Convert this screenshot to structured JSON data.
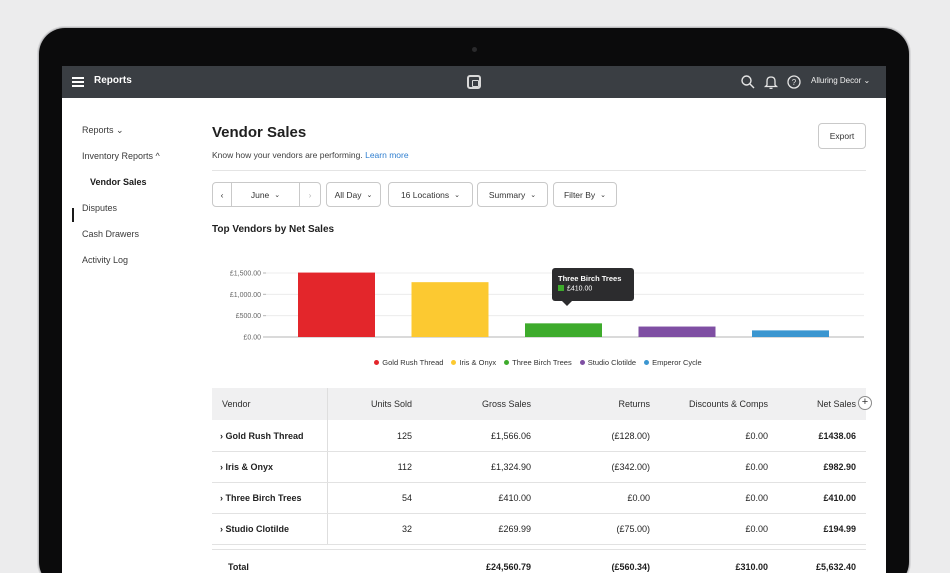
{
  "topbar": {
    "title": "Reports",
    "account": "Alluring Decor ⌄"
  },
  "sidebar": {
    "items": [
      {
        "label": "Reports ⌄"
      },
      {
        "label": "Inventory Reports  ^"
      },
      {
        "label": "Vendor Sales"
      },
      {
        "label": "Disputes"
      },
      {
        "label": "Cash Drawers"
      },
      {
        "label": "Activity Log"
      }
    ]
  },
  "page": {
    "title": "Vendor Sales",
    "subtitle": "Know how your vendors are performing.",
    "learn_more": "Learn more",
    "export": "Export"
  },
  "filters": {
    "prev": "‹",
    "month": "June",
    "next": "›",
    "allday": "All Day",
    "locations": "16 Locations",
    "summary": "Summary",
    "filterby": "Filter By",
    "chevron": "⌄"
  },
  "chart_title": "Top Vendors by Net Sales",
  "chart_data": {
    "type": "bar",
    "categories": [
      "Gold Rush Thread",
      "Iris & Onyx",
      "Three Birch Trees",
      "Studio Clotilde",
      "Emperor Cycle"
    ],
    "values": [
      1510,
      1285,
      320,
      245,
      155
    ],
    "colors": [
      "#e3262b",
      "#fcc931",
      "#3eab2c",
      "#7f4fa3",
      "#3b96d0"
    ],
    "y_ticks": [
      "£0.00",
      "£500.00",
      "£1,000.00",
      "£1,500.00"
    ],
    "ylim": [
      0,
      1500
    ],
    "tooltip": {
      "name": "Three Birch Trees",
      "value": "£410.00"
    },
    "legend": "bottom-center",
    "grid": true
  },
  "table": {
    "headers": [
      "Vendor",
      "Units Sold",
      "Gross Sales",
      "Returns",
      "Discounts & Comps",
      "Net Sales"
    ],
    "add_column": "+",
    "rows": [
      [
        "Gold Rush Thread",
        "125",
        "£1,566.06",
        "(£128.00)",
        "£0.00",
        "£1438.06"
      ],
      [
        "Iris & Onyx",
        "112",
        "£1,324.90",
        "(£342.00)",
        "£0.00",
        "£982.90"
      ],
      [
        "Three Birch Trees",
        "54",
        "£410.00",
        "£0.00",
        "£0.00",
        "£410.00"
      ],
      [
        "Studio Clotilde",
        "32",
        "£269.99",
        "(£75.00)",
        "£0.00",
        "£194.99"
      ]
    ],
    "row_prefix": "›",
    "total": [
      "Total",
      "",
      "£24,560.79",
      "(£560.34)",
      "£310.00",
      "£5,632.40"
    ]
  }
}
